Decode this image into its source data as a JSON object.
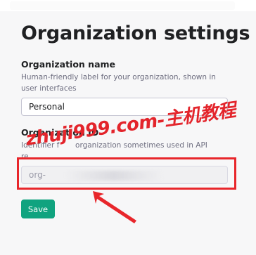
{
  "page": {
    "title": "Organization settings"
  },
  "org_name": {
    "label": "Organization name",
    "help": "Human-friendly label for your organization, shown in user interfaces",
    "value": "Personal"
  },
  "org_id": {
    "label": "Organization ID",
    "help_visible_start": "Identifier f",
    "help_visible_end": "organization sometimes used in API",
    "help_second_line_start": "re",
    "value_prefix": "org-"
  },
  "actions": {
    "save_label": "Save"
  },
  "overlay": {
    "watermark_text": "zhuji999.com-主机教程",
    "annotation_color": "#e8262b"
  },
  "colors": {
    "accent": "#10a37f",
    "text": "#202123",
    "muted": "#6e6e80"
  }
}
